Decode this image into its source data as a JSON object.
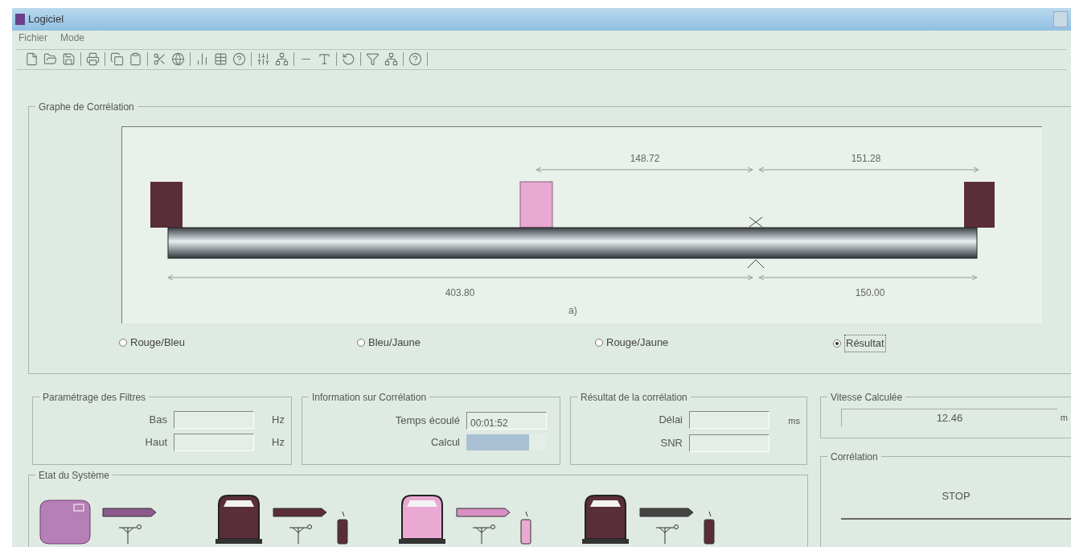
{
  "window": {
    "title": "Logiciel"
  },
  "menu": [
    "Fichier",
    "Mode"
  ],
  "correlation_graph": {
    "title": "Graphe de Corrélation",
    "top_distances": [
      "148.72",
      "151.28"
    ],
    "bottom_distances": [
      "403.80",
      "150.00"
    ],
    "axis_label": "a)",
    "options": [
      {
        "label": "Rouge/Bleu",
        "selected": false
      },
      {
        "label": "Bleu/Jaune",
        "selected": false
      },
      {
        "label": "Rouge/Jaune",
        "selected": false
      },
      {
        "label": "Résultat",
        "selected": true
      }
    ]
  },
  "filters": {
    "title": "Paramétrage des Filtres",
    "fields": [
      {
        "label": "Bas",
        "unit": "Hz"
      },
      {
        "label": "Haut",
        "unit": "Hz"
      }
    ]
  },
  "info": {
    "title": "Information sur Corrélation",
    "elapsed_label": "Temps écoulé",
    "elapsed": "00:01:52",
    "calc_label": "Calcul",
    "progress": {
      "level": 0.78
    }
  },
  "result": {
    "title": "Résultat de la corrélation",
    "fields": [
      {
        "label": "Délai",
        "unit": "ms"
      },
      {
        "label": "SNR"
      }
    ]
  },
  "speed": {
    "title": "Vitesse Calculée",
    "value": "12.46",
    "unit": "m"
  },
  "correlation": {
    "title": "Corrélation",
    "button": "STOP"
  },
  "system": {
    "title": "Etat du Système"
  }
}
